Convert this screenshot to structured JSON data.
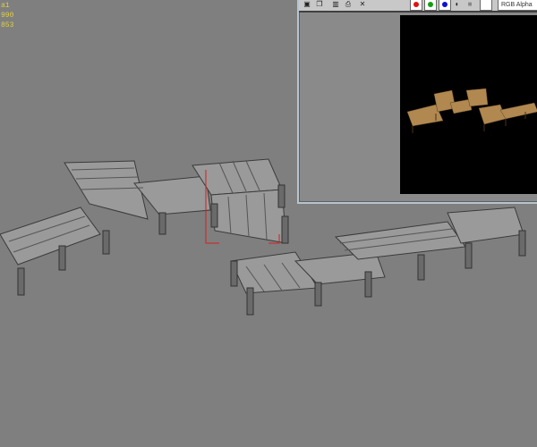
{
  "viewport": {
    "stats": [
      "a1",
      "990",
      "853"
    ]
  },
  "render_window": {
    "toolbar_icons": [
      "save-icon",
      "copy-icon",
      "clone-icon",
      "print-icon",
      "clear-icon"
    ],
    "channels": [
      {
        "name": "red-channel",
        "color": "#e01010"
      },
      {
        "name": "green-channel",
        "color": "#10a010"
      },
      {
        "name": "blue-channel",
        "color": "#1010d0"
      }
    ],
    "channel_display": "RGB Alpha"
  },
  "colors": {
    "viewport_bg": "#7f7f7f",
    "wood_render": "#b08850"
  }
}
